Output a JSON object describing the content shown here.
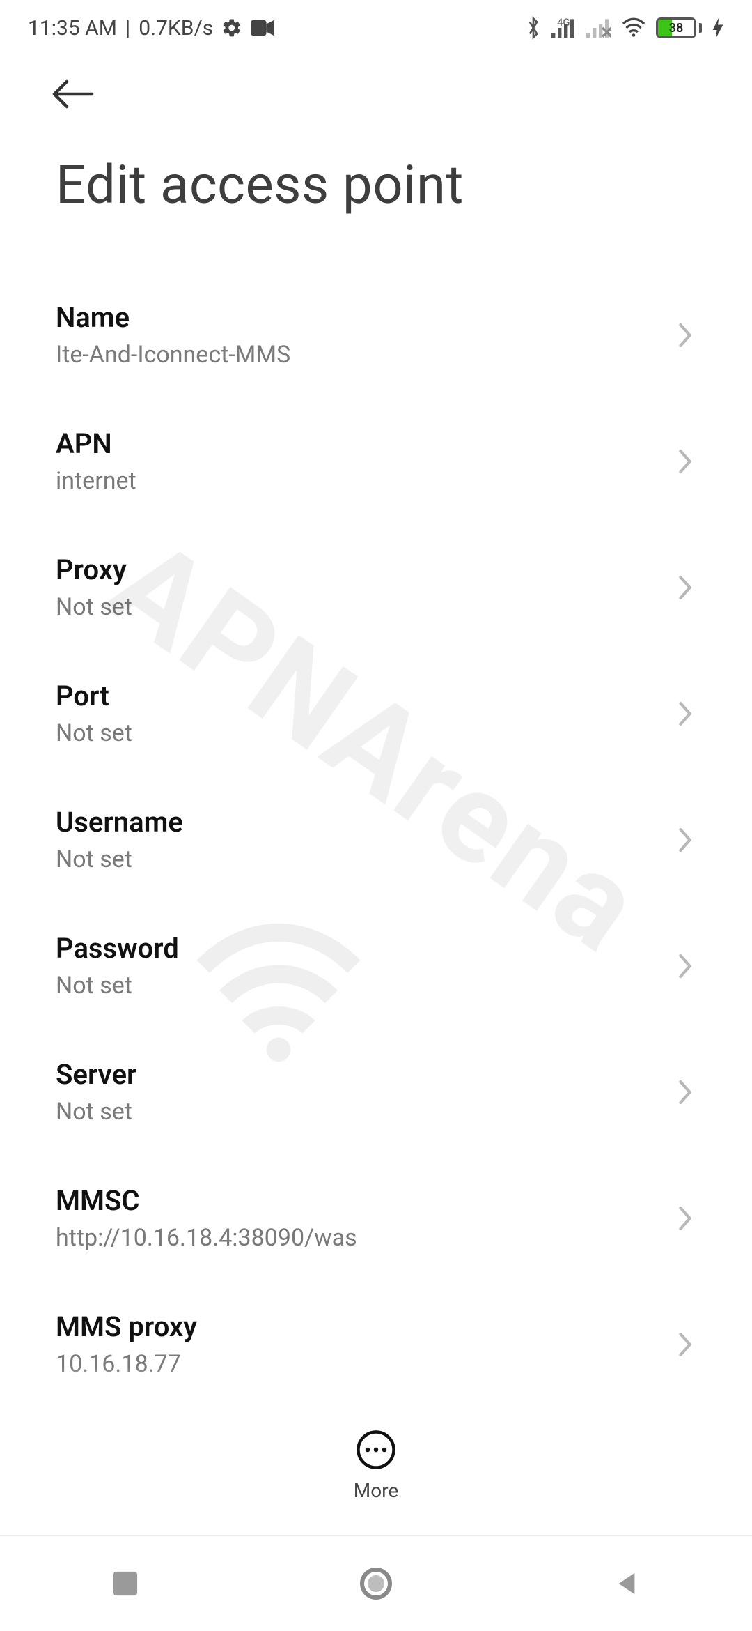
{
  "status": {
    "time": "11:35 AM",
    "speed": "0.7KB/s",
    "network_indicator": "4G",
    "battery_percent": "38",
    "battery_fill_percent": 38
  },
  "page": {
    "title": "Edit access point"
  },
  "fields": [
    {
      "key": "name",
      "label": "Name",
      "value": "Ite-And-Iconnect-MMS"
    },
    {
      "key": "apn",
      "label": "APN",
      "value": "internet"
    },
    {
      "key": "proxy",
      "label": "Proxy",
      "value": "Not set"
    },
    {
      "key": "port",
      "label": "Port",
      "value": "Not set"
    },
    {
      "key": "username",
      "label": "Username",
      "value": "Not set"
    },
    {
      "key": "password",
      "label": "Password",
      "value": "Not set"
    },
    {
      "key": "server",
      "label": "Server",
      "value": "Not set"
    },
    {
      "key": "mmsc",
      "label": "MMSC",
      "value": "http://10.16.18.4:38090/was"
    },
    {
      "key": "mms_proxy",
      "label": "MMS proxy",
      "value": "10.16.18.77"
    }
  ],
  "action_bar": {
    "more": "More"
  },
  "watermark_text": "APNArena"
}
